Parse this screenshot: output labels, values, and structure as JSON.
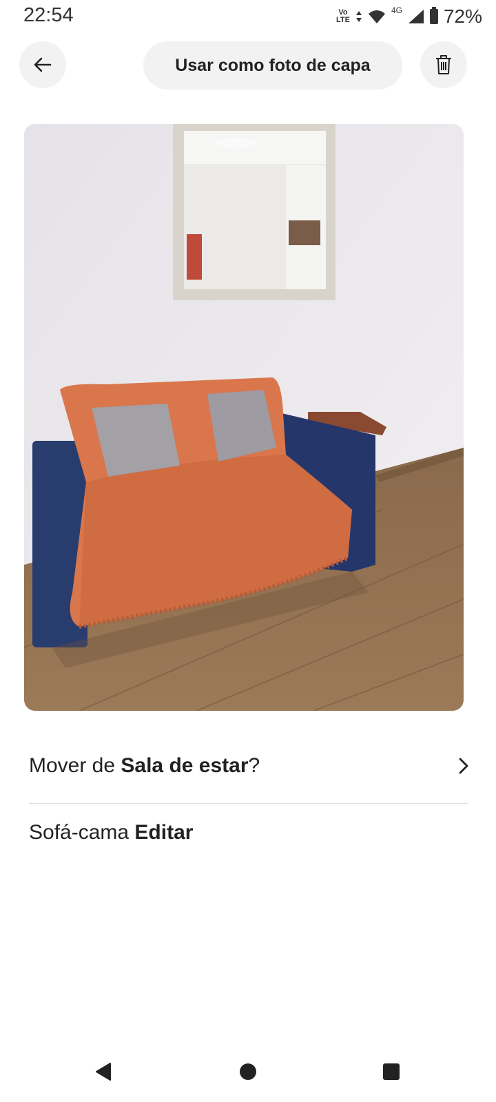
{
  "status_bar": {
    "time": "22:54",
    "network_top": "Vo",
    "network_bottom": "LTE",
    "network_type": "4G",
    "battery": "72%"
  },
  "toolbar": {
    "cover_label": "Usar como foto de capa",
    "back_icon": "arrow-left-icon",
    "delete_icon": "trash-icon"
  },
  "photo": {
    "description_icon": "room-photo"
  },
  "move_row": {
    "prefix": "Mover de ",
    "room": "Sala de estar",
    "suffix": "?"
  },
  "name_row": {
    "item": "Sofá-cama ",
    "edit_label": "Editar"
  },
  "colors": {
    "button_bg": "#f2f2f2",
    "text": "#222222",
    "divider": "#dddddd"
  }
}
